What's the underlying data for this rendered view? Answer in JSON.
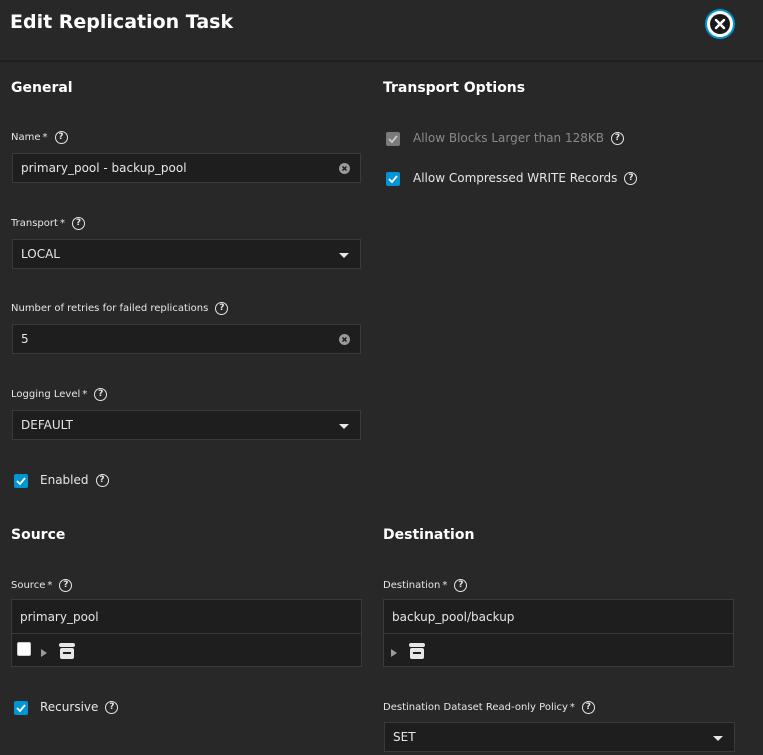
{
  "header": {
    "title": "Edit Replication Task"
  },
  "general": {
    "title": "General",
    "name": {
      "label": "Name",
      "required": "*",
      "value": "primary_pool - backup_pool"
    },
    "transport": {
      "label": "Transport",
      "required": "*",
      "value": "LOCAL"
    },
    "retries": {
      "label": "Number of retries for failed replications",
      "value": "5"
    },
    "logging": {
      "label": "Logging Level",
      "required": "*",
      "value": "DEFAULT"
    },
    "enabled": {
      "label": "Enabled",
      "checked": true
    }
  },
  "transport_options": {
    "title": "Transport Options",
    "large_blocks": {
      "label": "Allow Blocks Larger than 128KB",
      "checked": true,
      "disabled": true
    },
    "compressed": {
      "label": "Allow Compressed WRITE Records",
      "checked": true
    }
  },
  "source": {
    "title": "Source",
    "label": "Source",
    "required": "*",
    "value": "primary_pool",
    "recursive": {
      "label": "Recursive",
      "checked": true
    }
  },
  "destination": {
    "title": "Destination",
    "label": "Destination",
    "required": "*",
    "value": "backup_pool/backup",
    "readonly_policy": {
      "label": "Destination Dataset Read-only Policy",
      "required": "*",
      "value": "SET"
    }
  },
  "icons": {
    "help": "?",
    "close": "close-icon",
    "clear": "clear-icon",
    "dataset": "dataset-icon"
  },
  "colors": {
    "accent": "#0095d5",
    "background": "#282828",
    "field": "#1e1e1e"
  }
}
